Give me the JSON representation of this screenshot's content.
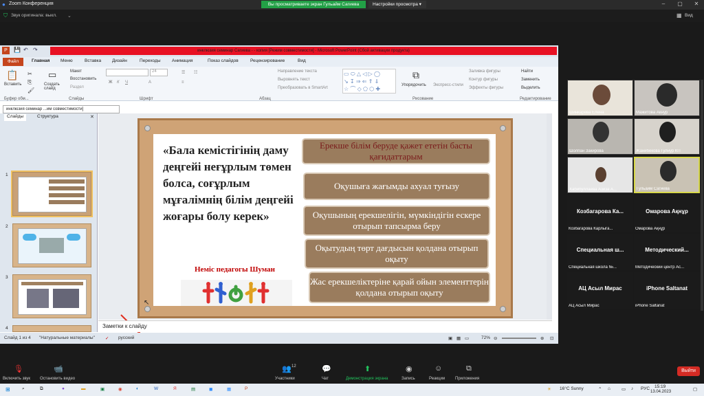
{
  "zoom": {
    "title": "Zoom Конференция",
    "share_banner": "Вы просматриваете экран Гульайм Сагиева",
    "view_settings": "Настройки просмотра",
    "audio_status": "Звук оригинала: выкл.",
    "view": "Вид"
  },
  "ppt": {
    "title": "инклюзия семинар Сагиева - - копия [Режим совместимости] - Microsoft PowerPoint (Сбой активации продукта)",
    "menu": [
      "Файл",
      "Главная",
      "Меню",
      "Вставка",
      "Дизайн",
      "Переходы",
      "Анимация",
      "Показ слайдов",
      "Рецензирование",
      "Вид"
    ],
    "ribbon": {
      "paste": "Вставить",
      "create_slide": "Создать слайд",
      "layout": "Макет",
      "restore": "Восстановить",
      "section": "Раздел",
      "clipboard": "Буфер обм...",
      "slides": "Слайды",
      "font": "Шрифт",
      "paragraph": "Абзац",
      "drawing": "Рисование",
      "editing": "Редактирование",
      "font_size": "24",
      "text_direction": "Направление текста",
      "align_text": "Выровнять текст",
      "smartart": "Преобразовать в SmartArt",
      "arrange": "Упорядочить",
      "quick_styles": "Экспресс-стили",
      "fill": "Заливка фигуры",
      "outline": "Контур фигуры",
      "effects": "Эффекты фигуры",
      "find": "Найти",
      "replace": "Заменить",
      "select": "Выделить"
    },
    "doc_tab": "инклюзия семинар ...им совместимости]",
    "panel_tabs": [
      "Слайды",
      "Структура"
    ],
    "slide": {
      "quote": "«Бала кемістігінің даму деңгейі неғұрлым төмен болса, соғұрлым мұғалімнің білім деңгейі жоғары болу керек»",
      "author": "Неміс педагогы Шуман",
      "boxes": [
        "Ерекше білім беруде қажет ететін басты қағидаттарым",
        "Оқушыға жағымды ахуал туғызу",
        "Оқушының ерекшелігін, мүмкіндігін ескере отырып тапсырма беру",
        "Оқытудың төрт дағдысын  қолдана отырып оқыту",
        "Жас ерекшеліктеріне қарай ойын элементтерін қолдана отырып оқыту"
      ]
    },
    "notes_placeholder": "Заметки к слайду",
    "status": {
      "slide": "Слайд 1 из 4",
      "theme": "\"Натуральные материалы\"",
      "lang": "русский",
      "zoom": "72%"
    }
  },
  "participants": [
    {
      "name": "Шинкарева Елена"
    },
    {
      "name": "Мажитова Акнур"
    },
    {
      "name": "Шолпан Закирова"
    },
    {
      "name": "Жанибекова Гулнур КП"
    },
    {
      "name": "Хабибуллаева Азиза А..."
    },
    {
      "name": "Гульайм Сагиева"
    },
    {
      "title": "Козбагарова  Ка...",
      "name": "Козбагарова Карлыга..."
    },
    {
      "title": "Омарова Ақнұр",
      "name": "Омарова Ақнұр"
    },
    {
      "title": "Специальная ш...",
      "name": "Специальная школа №..."
    },
    {
      "title": "Методический...",
      "name": "Методический центр Ас..."
    },
    {
      "title": "АЦ Асыл Мирас",
      "name": "АЦ Асыл Мирас"
    },
    {
      "title": "iPhone Saltanat",
      "name": "iPhone Saltanat"
    }
  ],
  "toolbar": {
    "mute": "Включить звук",
    "video": "Остановить видео",
    "participants": "Участники",
    "participants_count": "12",
    "chat": "Чат",
    "share": "Демонстрация экрана",
    "record": "Запись",
    "reactions": "Реакции",
    "apps": "Приложения",
    "leave": "Выйти"
  },
  "taskbar": {
    "weather": "16°C  Sunny",
    "lang": "РУС",
    "time": "15:19",
    "date": "13.04.2023"
  }
}
